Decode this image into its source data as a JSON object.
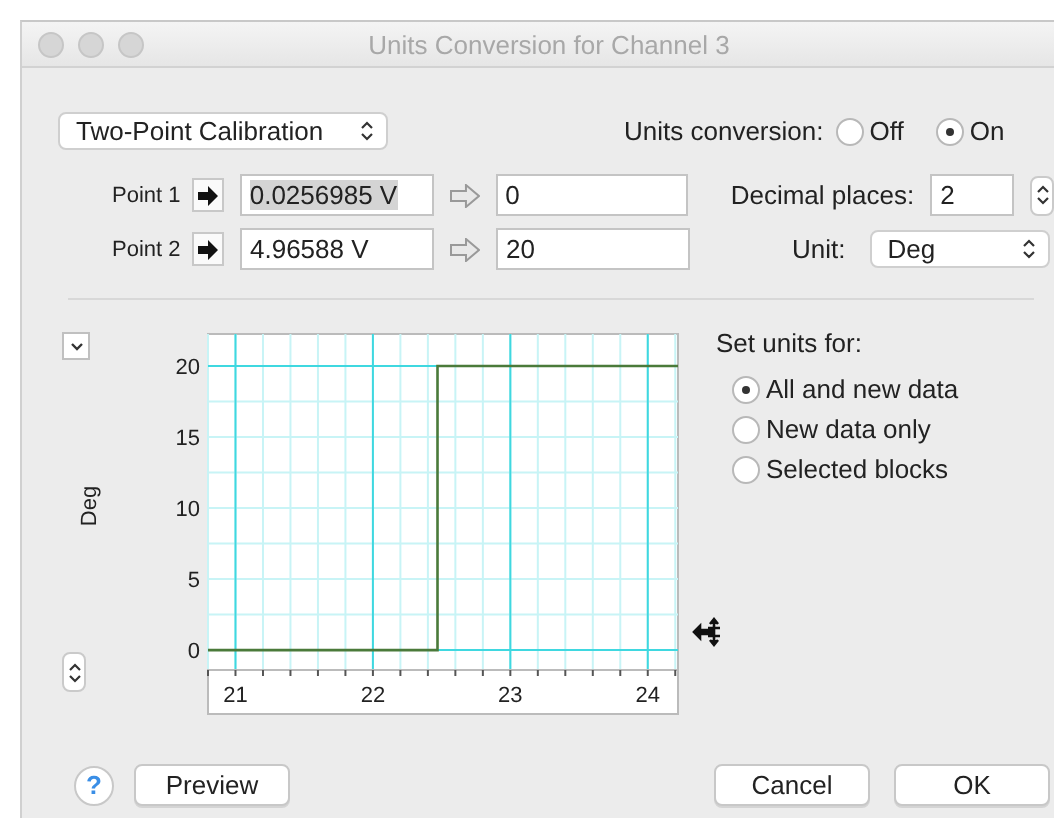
{
  "window": {
    "title": "Units Conversion for Channel 3"
  },
  "method_select": {
    "value": "Two-Point Calibration"
  },
  "units_conversion": {
    "label": "Units conversion:",
    "options": [
      {
        "label": "Off",
        "selected": false
      },
      {
        "label": "On",
        "selected": true
      }
    ]
  },
  "points": [
    {
      "label": "Point 1",
      "raw": "0.0256985 V",
      "raw_highlighted": true,
      "converted": "0"
    },
    {
      "label": "Point 2",
      "raw": "4.96588 V",
      "raw_highlighted": false,
      "converted": "20"
    }
  ],
  "decimal_places": {
    "label": "Decimal places:",
    "value": "2"
  },
  "unit": {
    "label": "Unit:",
    "value": "Deg"
  },
  "chart": {
    "chart_data": {
      "type": "line",
      "ylabel": "Deg",
      "x": [
        20.8,
        22.47,
        22.47,
        24.22
      ],
      "series": [
        {
          "color": "#4a7a3a",
          "values": [
            0,
            0,
            20,
            20
          ]
        }
      ],
      "grid": true,
      "xlim": [
        20.8,
        24.22
      ],
      "ylim": [
        -1.4,
        22.25
      ],
      "xticks": [
        21,
        22,
        23,
        24
      ],
      "yticks": [
        0,
        5,
        10,
        15,
        20
      ]
    }
  },
  "set_units": {
    "label": "Set units for:",
    "options": [
      {
        "label": "All and new data",
        "selected": true
      },
      {
        "label": "New data only",
        "selected": false
      },
      {
        "label": "Selected blocks",
        "selected": false
      }
    ]
  },
  "buttons": {
    "help": "?",
    "preview": "Preview",
    "cancel": "Cancel",
    "ok": "OK"
  }
}
